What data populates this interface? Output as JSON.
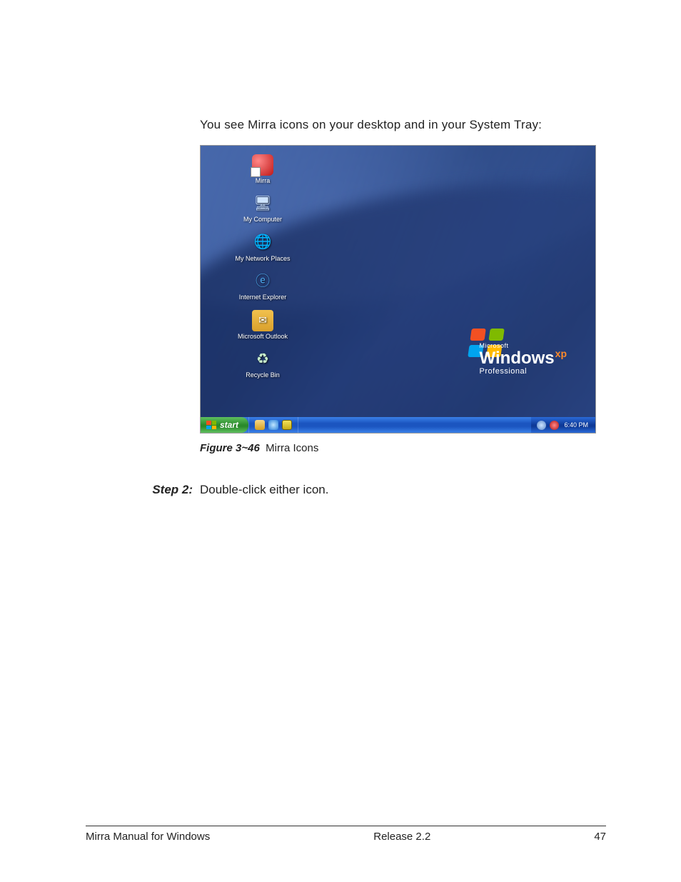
{
  "intro_text": "You see Mirra icons on your desktop and in your System Tray:",
  "screenshot": {
    "desktop_icons": [
      {
        "label": "Mirra",
        "kind": "mirra"
      },
      {
        "label": "My Computer",
        "kind": "computer",
        "glyph": "🖥"
      },
      {
        "label": "My Network Places",
        "kind": "network",
        "glyph": "🌐"
      },
      {
        "label": "Internet Explorer",
        "kind": "ie",
        "glyph": "ⓔ"
      },
      {
        "label": "Microsoft Outlook",
        "kind": "outlook",
        "glyph": "✉"
      },
      {
        "label": "Recycle Bin",
        "kind": "recycle",
        "glyph": "♻"
      }
    ],
    "branding": {
      "company": "Microsoft",
      "product": "Windows",
      "suffix": "xp",
      "edition": "Professional"
    },
    "taskbar": {
      "start_label": "start",
      "quicklaunch_icons": [
        "mail",
        "ie",
        "mirra"
      ],
      "systray_icons": [
        "vol",
        "mirra"
      ],
      "clock": "6:40 PM"
    }
  },
  "figure": {
    "number": "Figure 3~46",
    "caption": "Mirra Icons"
  },
  "step": {
    "label": "Step 2:",
    "text": "Double-click either icon."
  },
  "footer": {
    "left": "Mirra Manual for Windows",
    "center": "Release 2.2",
    "right": "47"
  }
}
